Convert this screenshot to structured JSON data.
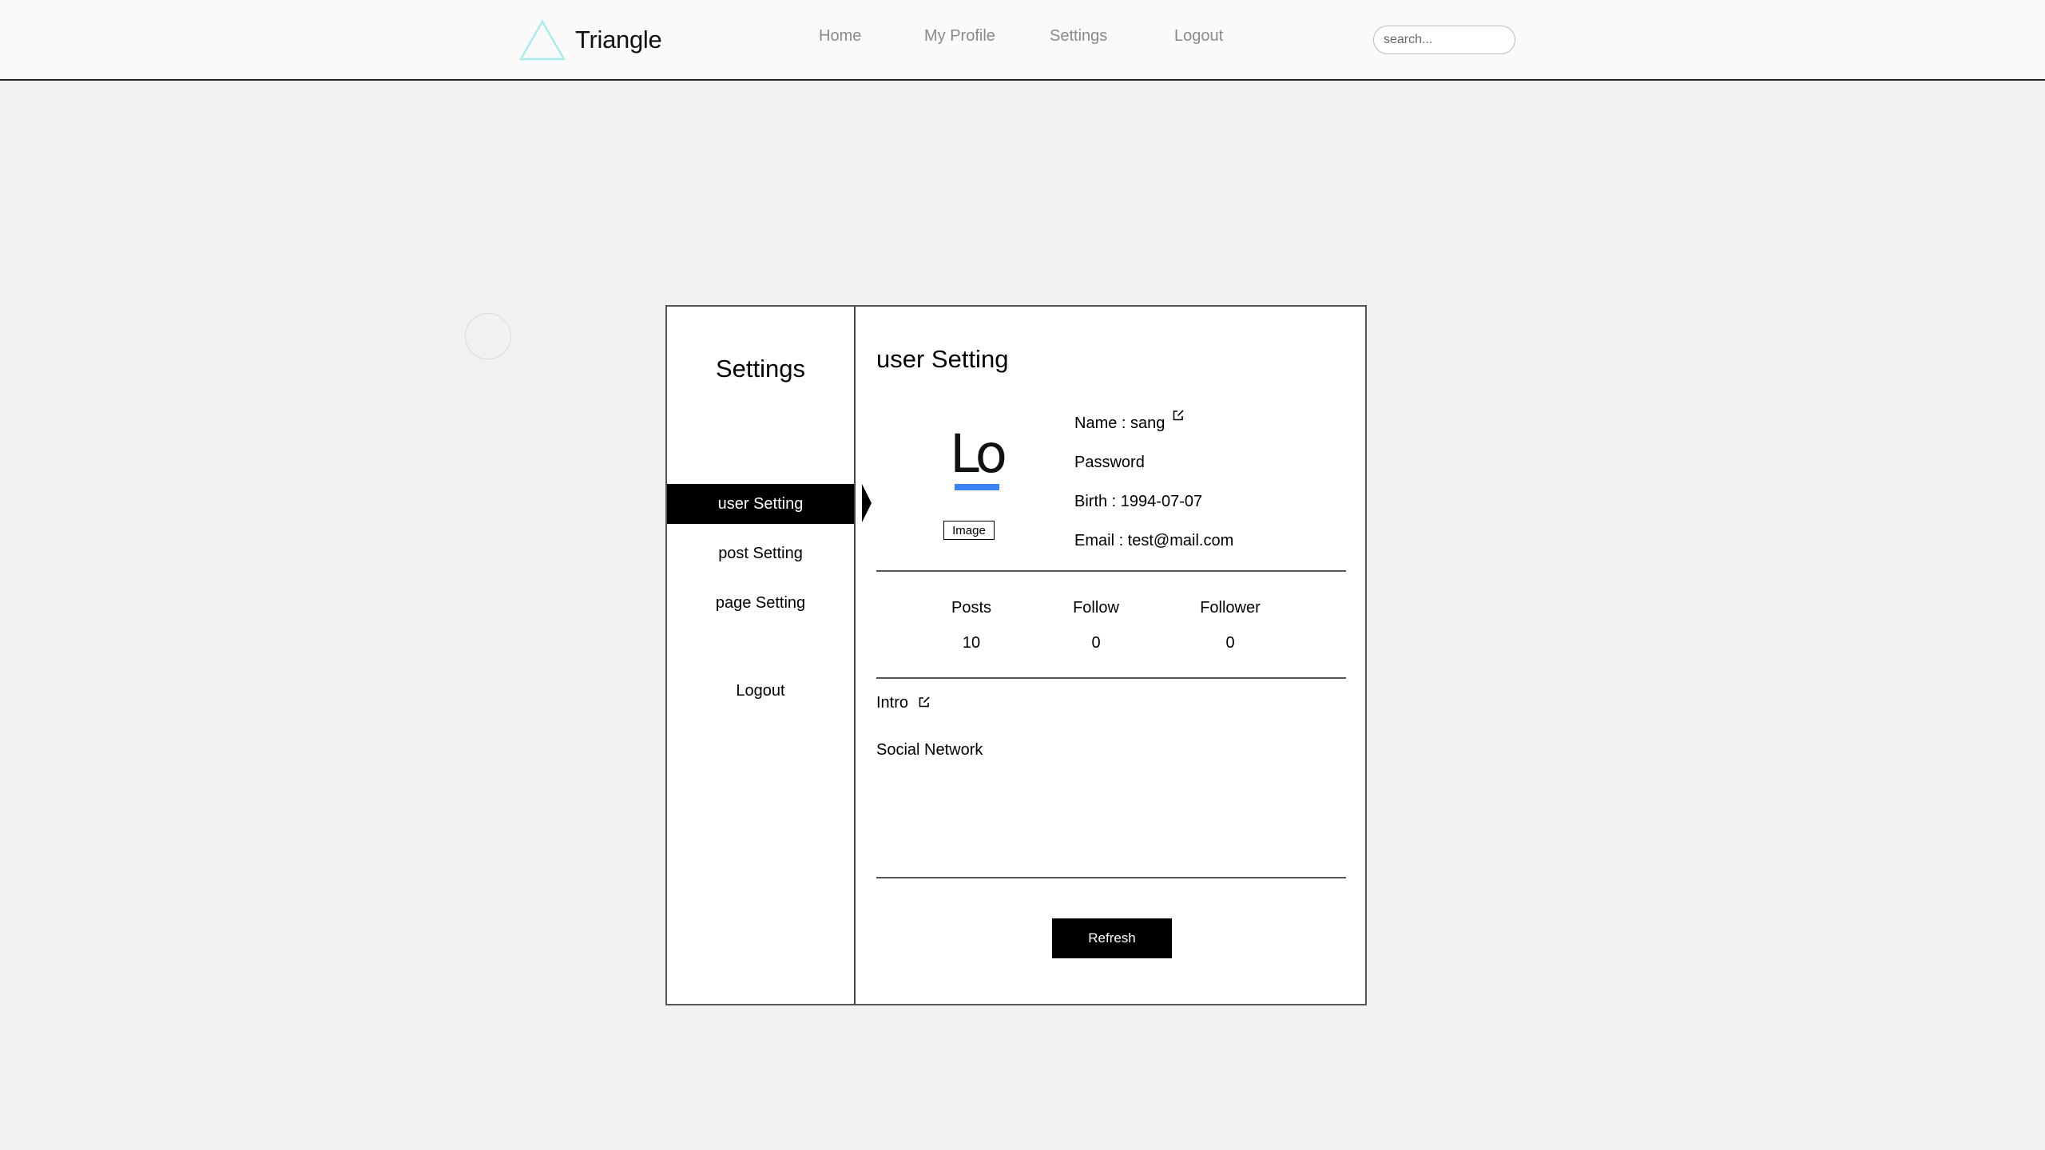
{
  "header": {
    "brand": "Triangle",
    "nav": [
      "Home",
      "My Profile",
      "Settings",
      "Logout"
    ],
    "search_placeholder": "search..."
  },
  "sidebar": {
    "title": "Settings",
    "items": [
      {
        "label": "user Setting",
        "active": true
      },
      {
        "label": "post Setting",
        "active": false
      },
      {
        "label": "page Setting",
        "active": false
      }
    ],
    "logout": "Logout"
  },
  "main": {
    "title": "user Setting",
    "avatar_text": "Lo",
    "image_button": "Image",
    "name": "Name : sang",
    "password": "Password",
    "birth": "Birth : 1994-07-07",
    "email": "Email : test@mail.com",
    "stats": [
      {
        "label": "Posts",
        "value": "10"
      },
      {
        "label": "Follow",
        "value": "0"
      },
      {
        "label": "Follower",
        "value": "0"
      }
    ],
    "intro": "Intro",
    "social": "Social Network",
    "refresh": "Refresh"
  },
  "colors": {
    "accent_underline": "#3b82f6",
    "logo_triangle": "#a8ecec"
  }
}
